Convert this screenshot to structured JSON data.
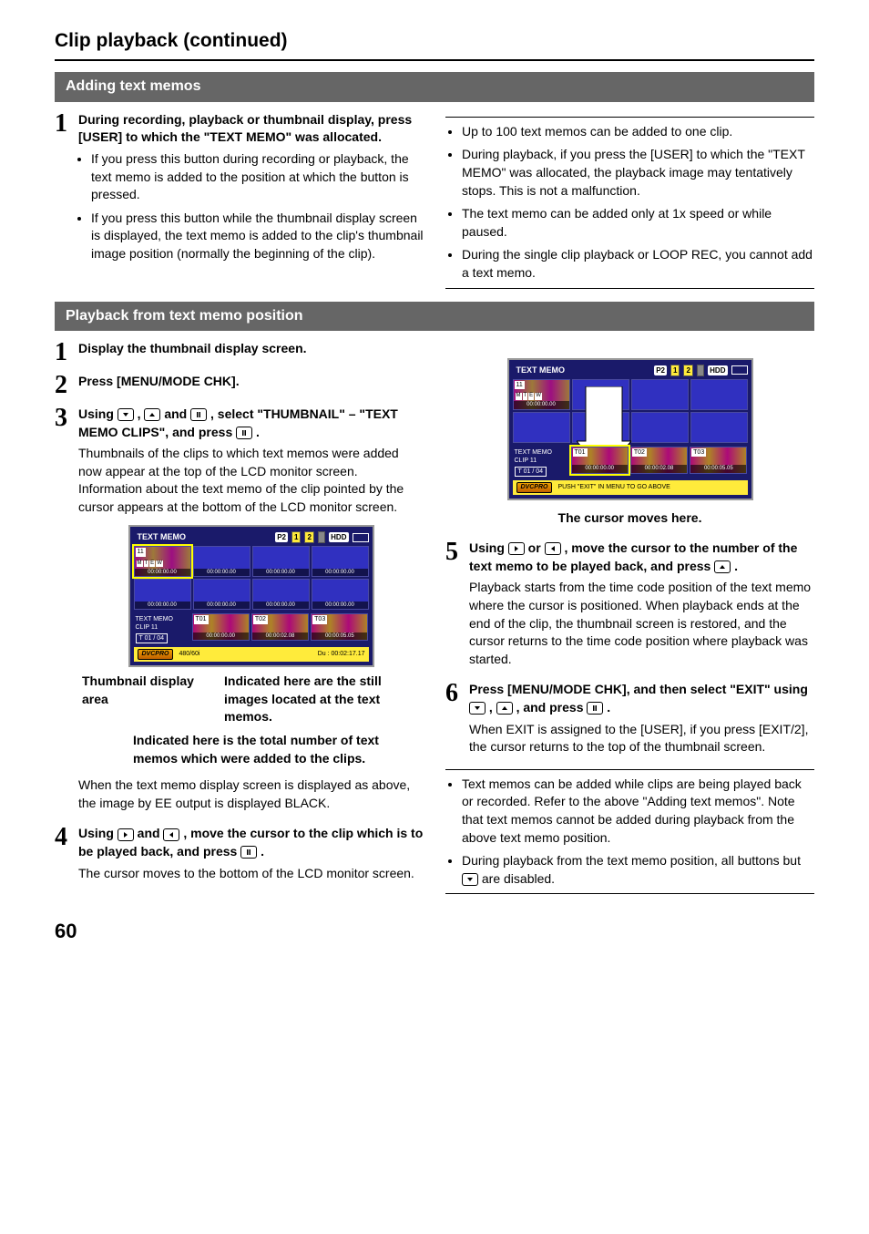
{
  "page": {
    "title": "Clip playback (continued)",
    "number": "60"
  },
  "sections": {
    "adding": "Adding text memos",
    "playback": "Playback from text memo position"
  },
  "adding_step1": {
    "bold": "During recording, playback or thumbnail display, press [USER] to which the \"TEXT MEMO\" was allocated.",
    "bullets": [
      "If you press this button during recording or playback, the text memo is added to the position at which the button is pressed.",
      "If you press this button while the thumbnail display screen is displayed, the text memo is added to the clip's thumbnail image position (normally the beginning of the clip)."
    ]
  },
  "adding_right_bullets": [
    "Up to 100 text memos can be added to one clip.",
    "During playback, if you press the [USER] to which the \"TEXT MEMO\" was allocated, the playback image may tentatively stops. This is not a malfunction.",
    "The text memo can be added only at 1x speed or while paused.",
    "During the single clip playback or LOOP REC, you cannot add a text memo."
  ],
  "pb": {
    "s1": "Display the thumbnail display screen.",
    "s2": "Press [MENU/MODE CHK].",
    "s3_bold_a": "Using ",
    "s3_bold_b": ", ",
    "s3_bold_c": " and ",
    "s3_bold_d": ", select \"THUMBNAIL\" – \"TEXT MEMO CLIPS\", and press ",
    "s3_bold_e": ".",
    "s3_text": "Thumbnails of the clips to which text memos were added now appear at the top of the LCD monitor screen. Information about the text memo of the clip pointed by the cursor appears at the bottom of the LCD monitor screen.",
    "s4_bold_a": "Using ",
    "s4_bold_b": " and ",
    "s4_bold_c": ", move the cursor to the clip which is to be played back, and press ",
    "s4_bold_d": ".",
    "s4_text": "The cursor moves to the bottom of the LCD monitor screen.",
    "s5_bold_a": "Using ",
    "s5_bold_b": " or ",
    "s5_bold_c": ", move the cursor to the number of the text memo to be played back, and press ",
    "s5_bold_d": ".",
    "s5_text": "Playback starts from the time code position of the text memo where the cursor is positioned. When playback ends at the end of the clip, the thumbnail screen is restored, and the cursor returns to the time code position where playback was started.",
    "s6_bold_a": "Press [MENU/MODE CHK], and then select \"EXIT\" using ",
    "s6_bold_b": ", ",
    "s6_bold_c": ", and press ",
    "s6_bold_d": ".",
    "s6_text": "When EXIT is assigned to the [USER], if you press [EXIT/2], the cursor returns to the top of the thumbnail screen."
  },
  "fig1_labels": {
    "left": "Thumbnail display area",
    "right": "Indicated here are the still images located at the text memos.",
    "bottom": "Indicated here is the total number of text memos which were added to the clips.",
    "below_text": "When the text memo display screen is displayed as above, the image by EE output is displayed BLACK."
  },
  "fig2_caption": "The cursor moves here.",
  "lcd": {
    "header": "TEXT MEMO",
    "p2": "P2",
    "s1": "1",
    "s2": "2",
    "hdd": "HDD",
    "clip_num": "11",
    "tc0": "00:00:00.00",
    "memo_label1": "TEXT MEMO",
    "memo_label2": "CLIP  11",
    "memo_counter": "T 01  /  04",
    "m_t01": "T01",
    "m_t02": "T02",
    "m_t03": "T03",
    "m_tc1": "00:00:00.00",
    "m_tc2": "00:00:02.08",
    "m_tc3": "00:00:05.05",
    "dvcpro": "DVCPRO",
    "footer_left": "480/60i",
    "footer_right": "Du   : 00:02:17.17",
    "footer_push": "PUSH \"EXIT\" IN MENU TO GO ABOVE"
  },
  "bottom_bullets": [
    "Text memos can be added while clips are being played back or recorded. Refer to the above \"Adding text memos\". Note that text memos cannot be added during playback from the above text memo position.",
    "During playback from the text memo position, all buttons but   are disabled."
  ],
  "bottom_bullet2_a": "During playback from the text memo position, all buttons but ",
  "bottom_bullet2_b": " are disabled."
}
